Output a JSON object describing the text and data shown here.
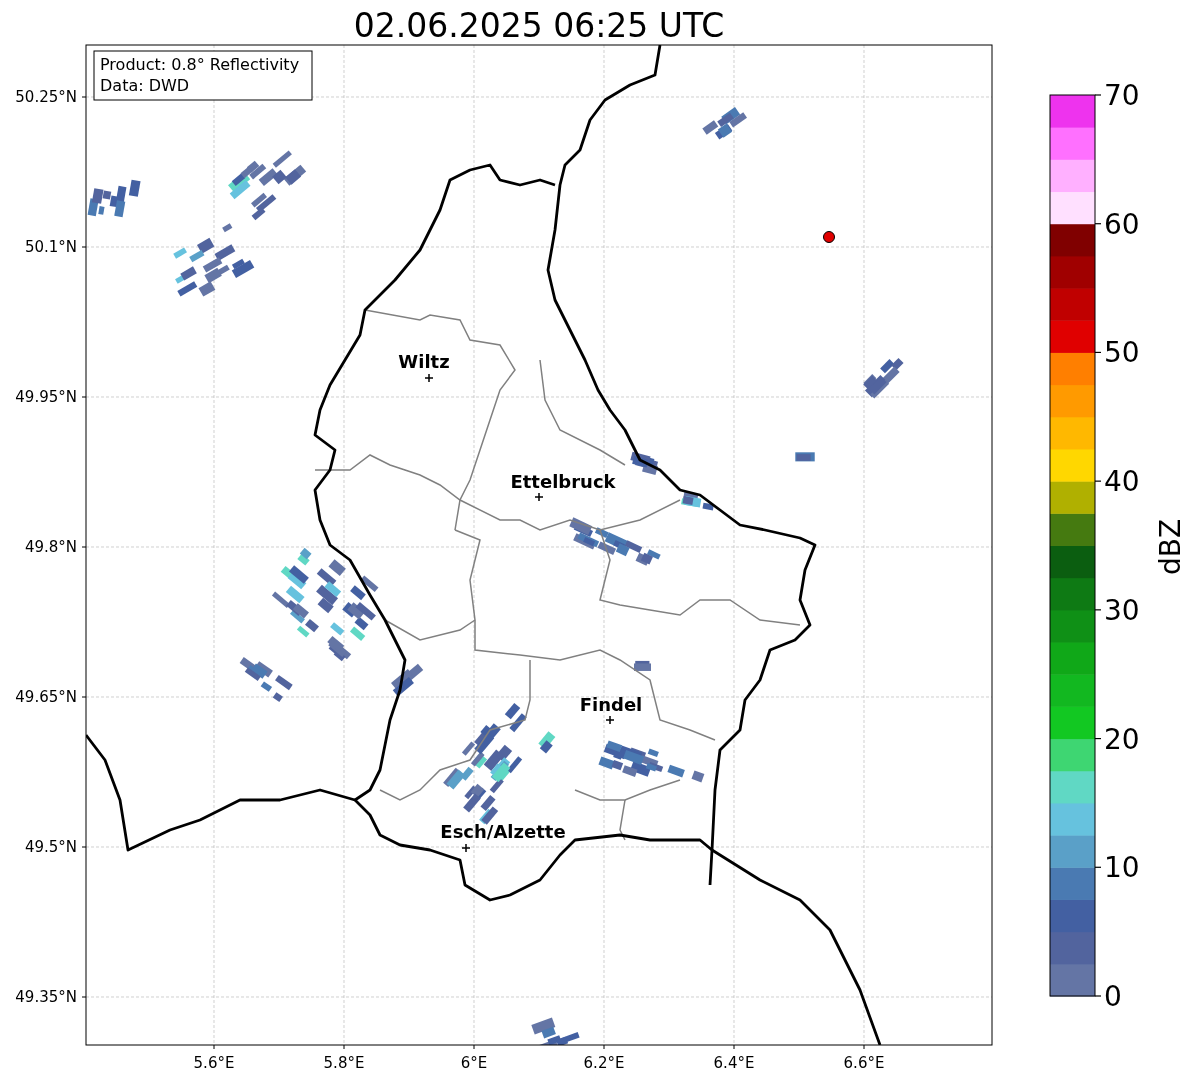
{
  "title": "02.06.2025 06:25 UTC",
  "info_box": {
    "lines": [
      "Product: 0.8° Reflectivity",
      "Data: DWD"
    ]
  },
  "map": {
    "lat_labels": [
      "50.25°N",
      "50.1°N",
      "49.95°N",
      "49.8°N",
      "49.65°N",
      "49.5°N",
      "49.35°N"
    ],
    "lon_labels": [
      "5.6°E",
      "5.8°E",
      "6°E",
      "6.2°E",
      "6.4°E",
      "6.6°E"
    ],
    "cities": [
      {
        "name": "Wiltz"
      },
      {
        "name": "Ettelbruck"
      },
      {
        "name": "Findel"
      },
      {
        "name": "Esch/Alzette"
      }
    ]
  },
  "colorbar": {
    "label": "dBZ",
    "ticks": [
      "70",
      "60",
      "50",
      "40",
      "30",
      "20",
      "10",
      "0"
    ],
    "bins": [
      {
        "color": "#6475a5"
      },
      {
        "color": "#52649e"
      },
      {
        "color": "#4360a2"
      },
      {
        "color": "#4a7ab2"
      },
      {
        "color": "#5aa0c8"
      },
      {
        "color": "#66c2de"
      },
      {
        "color": "#60d8c4"
      },
      {
        "color": "#3ed672"
      },
      {
        "color": "#12c822"
      },
      {
        "color": "#12b820"
      },
      {
        "color": "#10a818"
      },
      {
        "color": "#0f9016"
      },
      {
        "color": "#0e7a14"
      },
      {
        "color": "#0b5e10"
      },
      {
        "color": "#457a10"
      },
      {
        "color": "#b0b000"
      },
      {
        "color": "#ffd700"
      },
      {
        "color": "#ffb800"
      },
      {
        "color": "#ff9a00"
      },
      {
        "color": "#ff7f00"
      },
      {
        "color": "#e00000"
      },
      {
        "color": "#c00000"
      },
      {
        "color": "#a00000"
      },
      {
        "color": "#800000"
      },
      {
        "color": "#ffe0ff"
      },
      {
        "color": "#ffb0ff"
      },
      {
        "color": "#ff70ff"
      },
      {
        "color": "#ee33ee"
      }
    ]
  }
}
